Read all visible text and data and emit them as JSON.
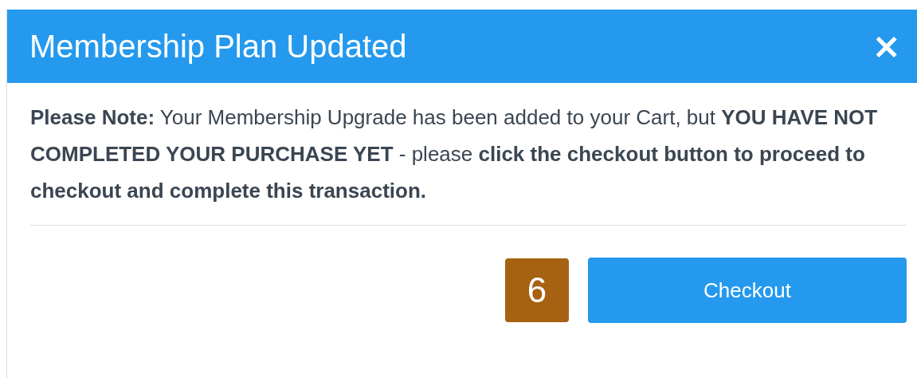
{
  "dialog": {
    "title": "Membership Plan Updated",
    "close": "×",
    "message": "**Please Note:** Your Membership Upgrade has been added to your Cart, but **YOU HAVE NOT COMPLETED YOUR PURCHASE YET** - please **click the checkout button to proceed to checkout and complete this transaction.**",
    "badge": "6",
    "buttons": [
      "Checkout"
    ]
  }
}
